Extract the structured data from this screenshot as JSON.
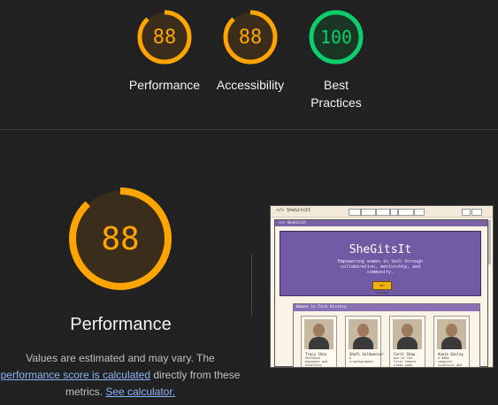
{
  "summary_gauges": [
    {
      "label": "Performance",
      "score": "88",
      "score_value": 88,
      "color": "#ffa400",
      "bg": "#3a2d1b"
    },
    {
      "label": "Accessibility",
      "score": "88",
      "score_value": 88,
      "color": "#ffa400",
      "bg": "#3a2d1b"
    },
    {
      "label_line1": "Best",
      "label_line2": "Practices",
      "score": "100",
      "score_value": 100,
      "color": "#0cce6b",
      "bg": "#1b3624"
    }
  ],
  "main": {
    "score": "88",
    "score_value": 88,
    "color": "#ffa400",
    "title": "Performance",
    "desc_part1": "Values are estimated and may vary. The ",
    "link_score": "performance score is calculated",
    "desc_part2": " directly from these metrics. ",
    "link_calculator": "See calculator."
  },
  "screenshot": {
    "logo": "</> SheGitsIt",
    "inner_title": "</> SheGitsIt",
    "hero_title": "SheGitsIt",
    "hero_subtitle": "Empowering women in tech through collaboration, mentorship, and community.",
    "hero_button": "Get Started",
    "section_title": "Women in Tech History",
    "cards": [
      {
        "name": "Tracy Chou",
        "desc": "Software engineer and diversity advocate"
      },
      {
        "name": "Shafi Goldwasser",
        "desc": "A cryptographer"
      },
      {
        "name": "Carol Shaw",
        "desc": "One of the first female video game designers"
      },
      {
        "name": "Annie Easley",
        "desc": "A NASA computer scientist and"
      }
    ]
  }
}
